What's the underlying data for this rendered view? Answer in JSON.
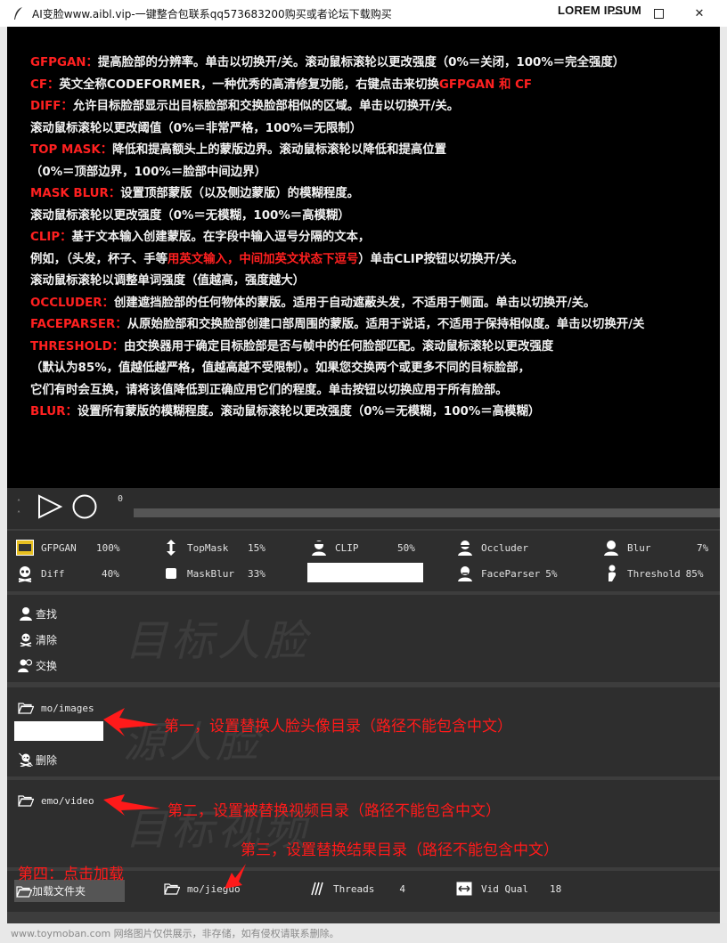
{
  "window": {
    "title": "AI变脸www.aibl.vip-一键整合包联系qq573683200购买或者论坛下载购买",
    "overlay_brand": "LOREM IPSUM"
  },
  "help": {
    "lines": [
      [
        {
          "t": "GFPGAN：",
          "k": 1
        },
        {
          "t": "提高脸部的分辨率。单击以切换开/关。滚动鼠标滚轮以更改强度（0%＝关闭，100%＝完全强度）",
          "k": 0
        }
      ],
      [
        {
          "t": "CF：",
          "k": 1
        },
        {
          "t": "英文全称CODEFORMER，一种优秀的高清修复功能，右键点击来切换",
          "k": 0
        },
        {
          "t": "GFPGAN 和 CF",
          "k": 1
        }
      ],
      [
        {
          "t": "DIFF：",
          "k": 1
        },
        {
          "t": "允许目标脸部显示出目标脸部和交换脸部相似的区域。单击以切换开/关。",
          "k": 0
        }
      ],
      [
        {
          "t": "滚动鼠标滚轮以更改阈值（0%＝非常严格，100%＝无限制）",
          "k": 0
        }
      ],
      [
        {
          "t": "TOP MASK：",
          "k": 1
        },
        {
          "t": "降低和提高额头上的蒙版边界。滚动鼠标滚轮以降低和提高位置",
          "k": 0
        }
      ],
      [
        {
          "t": "（0%＝顶部边界，100%＝脸部中间边界）",
          "k": 0
        }
      ],
      [
        {
          "t": "MASK BLUR：",
          "k": 1
        },
        {
          "t": "设置顶部蒙版（以及侧边蒙版）的模糊程度。",
          "k": 0
        }
      ],
      [
        {
          "t": "滚动鼠标滚轮以更改强度（0%＝无模糊，100%＝高模糊）",
          "k": 0
        }
      ],
      [
        {
          "t": "CLIP：",
          "k": 1
        },
        {
          "t": "基于文本输入创建蒙版。在字段中输入逗号分隔的文本，",
          "k": 0
        }
      ],
      [
        {
          "t": "例如，（头发，杯子、手等",
          "k": 0
        },
        {
          "t": "用英文输入，中间加英文状态下逗号",
          "k": 1
        },
        {
          "t": "）单击CLIP按钮以切换开/关。",
          "k": 0
        }
      ],
      [
        {
          "t": "滚动鼠标滚轮以调整单词强度（值越高，强度越大）",
          "k": 0
        }
      ],
      [
        {
          "t": "OCCLUDER：",
          "k": 1
        },
        {
          "t": "创建遮挡脸部的任何物体的蒙版。适用于自动遮蔽头发，不适用于侧面。单击以切换开/关。",
          "k": 0
        }
      ],
      [
        {
          "t": "FACEPARSER：",
          "k": 1
        },
        {
          "t": "从原始脸部和交换脸部创建口部周围的蒙版。适用于说话，不适用于保持相似度。单击以切换开/关",
          "k": 0
        }
      ],
      [
        {
          "t": "THRESHOLD：",
          "k": 1
        },
        {
          "t": "由交换器用于确定目标脸部是否与帧中的任何脸部匹配。滚动鼠标滚轮以更改强度",
          "k": 0
        }
      ],
      [
        {
          "t": "（默认为85%，值越低越严格，值越高越不受限制）。如果您交换两个或更多不同的目标脸部，",
          "k": 0
        }
      ],
      [
        {
          "t": "它们有时会互换，请将该值降低到正确应用它们的程度。单击按钮以切换应用于所有脸部。",
          "k": 0
        }
      ],
      [
        {
          "t": "BLUR：",
          "k": 1
        },
        {
          "t": "设置所有蒙版的模糊程度。滚动鼠标滚轮以更改强度（0%＝无模糊，100%＝高模糊）",
          "k": 0
        }
      ]
    ]
  },
  "playback": {
    "arrows_up": "˄",
    "arrows_down": "˄",
    "frame": "0",
    "position": 0
  },
  "switches": {
    "gfpgan": {
      "label": "GFPGAN",
      "value": "100%"
    },
    "topmask": {
      "label": "TopMask",
      "value": "15%"
    },
    "clip": {
      "label": "CLIP",
      "value": "50%"
    },
    "occluder": {
      "label": "Occluder",
      "value": ""
    },
    "blur": {
      "label": "Blur",
      "value": "7%"
    },
    "diff": {
      "label": "Diff",
      "value": "40%"
    },
    "maskblur": {
      "label": "MaskBlur",
      "value": "33%"
    },
    "faceparser": {
      "label": "FaceParser",
      "value": "5%"
    },
    "threshold": {
      "label": "Threshold",
      "value": "85%"
    },
    "clip_text": ""
  },
  "target_faces": {
    "watermark": "目标人脸",
    "find": "查找",
    "clear": "清除",
    "swap": "交换"
  },
  "source_faces": {
    "watermark": "源人脸",
    "folder": "mo/images",
    "input_value": "",
    "delete": "删除"
  },
  "target_videos": {
    "watermark": "目标视频",
    "folder": "emo/video"
  },
  "bottom": {
    "load": "加载文件夹",
    "output": "mo/jieguo",
    "threads_label": "Threads",
    "threads_value": "4",
    "vidqual_label": "Vid Qual",
    "vidqual_value": "18"
  },
  "annotations": {
    "a1": "第一，设置替换人脸头像目录（路径不能包含中文）",
    "a2": "第二，设置被替换视频目录（路径不能包含中文）",
    "a3": "第三，设置替换结果目录（路径不能包含中文）",
    "a4": "第四：点击加载"
  },
  "footer": "www.toymoban.com 网络图片仅供展示，非存储，如有侵权请联系删除。",
  "colors": {
    "keyword": "#ff2020",
    "annotation": "#ff1a1a",
    "panel": "#2e2e2e"
  }
}
